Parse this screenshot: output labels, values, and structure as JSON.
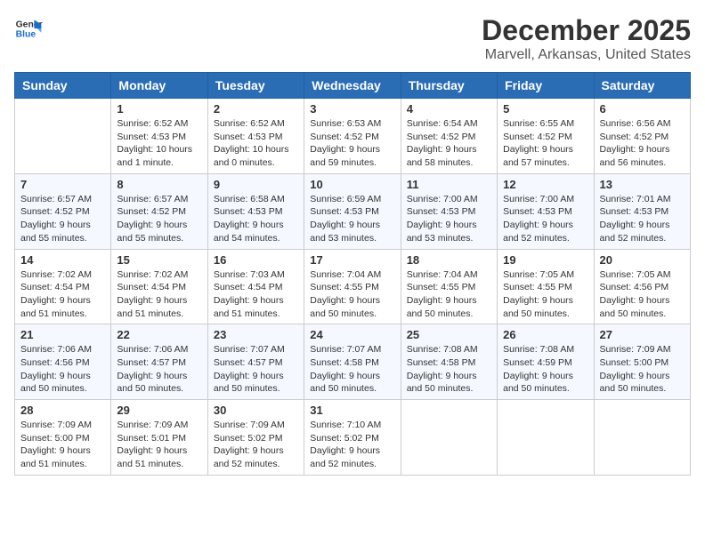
{
  "logo": {
    "line1": "General",
    "line2": "Blue"
  },
  "title": "December 2025",
  "subtitle": "Marvell, Arkansas, United States",
  "days_of_week": [
    "Sunday",
    "Monday",
    "Tuesday",
    "Wednesday",
    "Thursday",
    "Friday",
    "Saturday"
  ],
  "weeks": [
    [
      {
        "day": "",
        "sunrise": "",
        "sunset": "",
        "daylight": ""
      },
      {
        "day": "1",
        "sunrise": "Sunrise: 6:52 AM",
        "sunset": "Sunset: 4:53 PM",
        "daylight": "Daylight: 10 hours and 1 minute."
      },
      {
        "day": "2",
        "sunrise": "Sunrise: 6:52 AM",
        "sunset": "Sunset: 4:53 PM",
        "daylight": "Daylight: 10 hours and 0 minutes."
      },
      {
        "day": "3",
        "sunrise": "Sunrise: 6:53 AM",
        "sunset": "Sunset: 4:52 PM",
        "daylight": "Daylight: 9 hours and 59 minutes."
      },
      {
        "day": "4",
        "sunrise": "Sunrise: 6:54 AM",
        "sunset": "Sunset: 4:52 PM",
        "daylight": "Daylight: 9 hours and 58 minutes."
      },
      {
        "day": "5",
        "sunrise": "Sunrise: 6:55 AM",
        "sunset": "Sunset: 4:52 PM",
        "daylight": "Daylight: 9 hours and 57 minutes."
      },
      {
        "day": "6",
        "sunrise": "Sunrise: 6:56 AM",
        "sunset": "Sunset: 4:52 PM",
        "daylight": "Daylight: 9 hours and 56 minutes."
      }
    ],
    [
      {
        "day": "7",
        "sunrise": "Sunrise: 6:57 AM",
        "sunset": "Sunset: 4:52 PM",
        "daylight": "Daylight: 9 hours and 55 minutes."
      },
      {
        "day": "8",
        "sunrise": "Sunrise: 6:57 AM",
        "sunset": "Sunset: 4:52 PM",
        "daylight": "Daylight: 9 hours and 55 minutes."
      },
      {
        "day": "9",
        "sunrise": "Sunrise: 6:58 AM",
        "sunset": "Sunset: 4:53 PM",
        "daylight": "Daylight: 9 hours and 54 minutes."
      },
      {
        "day": "10",
        "sunrise": "Sunrise: 6:59 AM",
        "sunset": "Sunset: 4:53 PM",
        "daylight": "Daylight: 9 hours and 53 minutes."
      },
      {
        "day": "11",
        "sunrise": "Sunrise: 7:00 AM",
        "sunset": "Sunset: 4:53 PM",
        "daylight": "Daylight: 9 hours and 53 minutes."
      },
      {
        "day": "12",
        "sunrise": "Sunrise: 7:00 AM",
        "sunset": "Sunset: 4:53 PM",
        "daylight": "Daylight: 9 hours and 52 minutes."
      },
      {
        "day": "13",
        "sunrise": "Sunrise: 7:01 AM",
        "sunset": "Sunset: 4:53 PM",
        "daylight": "Daylight: 9 hours and 52 minutes."
      }
    ],
    [
      {
        "day": "14",
        "sunrise": "Sunrise: 7:02 AM",
        "sunset": "Sunset: 4:54 PM",
        "daylight": "Daylight: 9 hours and 51 minutes."
      },
      {
        "day": "15",
        "sunrise": "Sunrise: 7:02 AM",
        "sunset": "Sunset: 4:54 PM",
        "daylight": "Daylight: 9 hours and 51 minutes."
      },
      {
        "day": "16",
        "sunrise": "Sunrise: 7:03 AM",
        "sunset": "Sunset: 4:54 PM",
        "daylight": "Daylight: 9 hours and 51 minutes."
      },
      {
        "day": "17",
        "sunrise": "Sunrise: 7:04 AM",
        "sunset": "Sunset: 4:55 PM",
        "daylight": "Daylight: 9 hours and 50 minutes."
      },
      {
        "day": "18",
        "sunrise": "Sunrise: 7:04 AM",
        "sunset": "Sunset: 4:55 PM",
        "daylight": "Daylight: 9 hours and 50 minutes."
      },
      {
        "day": "19",
        "sunrise": "Sunrise: 7:05 AM",
        "sunset": "Sunset: 4:55 PM",
        "daylight": "Daylight: 9 hours and 50 minutes."
      },
      {
        "day": "20",
        "sunrise": "Sunrise: 7:05 AM",
        "sunset": "Sunset: 4:56 PM",
        "daylight": "Daylight: 9 hours and 50 minutes."
      }
    ],
    [
      {
        "day": "21",
        "sunrise": "Sunrise: 7:06 AM",
        "sunset": "Sunset: 4:56 PM",
        "daylight": "Daylight: 9 hours and 50 minutes."
      },
      {
        "day": "22",
        "sunrise": "Sunrise: 7:06 AM",
        "sunset": "Sunset: 4:57 PM",
        "daylight": "Daylight: 9 hours and 50 minutes."
      },
      {
        "day": "23",
        "sunrise": "Sunrise: 7:07 AM",
        "sunset": "Sunset: 4:57 PM",
        "daylight": "Daylight: 9 hours and 50 minutes."
      },
      {
        "day": "24",
        "sunrise": "Sunrise: 7:07 AM",
        "sunset": "Sunset: 4:58 PM",
        "daylight": "Daylight: 9 hours and 50 minutes."
      },
      {
        "day": "25",
        "sunrise": "Sunrise: 7:08 AM",
        "sunset": "Sunset: 4:58 PM",
        "daylight": "Daylight: 9 hours and 50 minutes."
      },
      {
        "day": "26",
        "sunrise": "Sunrise: 7:08 AM",
        "sunset": "Sunset: 4:59 PM",
        "daylight": "Daylight: 9 hours and 50 minutes."
      },
      {
        "day": "27",
        "sunrise": "Sunrise: 7:09 AM",
        "sunset": "Sunset: 5:00 PM",
        "daylight": "Daylight: 9 hours and 50 minutes."
      }
    ],
    [
      {
        "day": "28",
        "sunrise": "Sunrise: 7:09 AM",
        "sunset": "Sunset: 5:00 PM",
        "daylight": "Daylight: 9 hours and 51 minutes."
      },
      {
        "day": "29",
        "sunrise": "Sunrise: 7:09 AM",
        "sunset": "Sunset: 5:01 PM",
        "daylight": "Daylight: 9 hours and 51 minutes."
      },
      {
        "day": "30",
        "sunrise": "Sunrise: 7:09 AM",
        "sunset": "Sunset: 5:02 PM",
        "daylight": "Daylight: 9 hours and 52 minutes."
      },
      {
        "day": "31",
        "sunrise": "Sunrise: 7:10 AM",
        "sunset": "Sunset: 5:02 PM",
        "daylight": "Daylight: 9 hours and 52 minutes."
      },
      {
        "day": "",
        "sunrise": "",
        "sunset": "",
        "daylight": ""
      },
      {
        "day": "",
        "sunrise": "",
        "sunset": "",
        "daylight": ""
      },
      {
        "day": "",
        "sunrise": "",
        "sunset": "",
        "daylight": ""
      }
    ]
  ]
}
